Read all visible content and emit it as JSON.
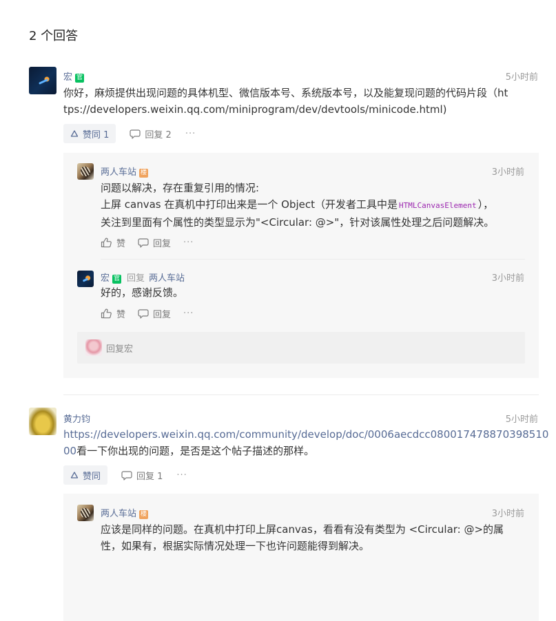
{
  "header": {
    "title": "2 个回答"
  },
  "answers": [
    {
      "author": "宏",
      "badge": "官",
      "time": "5小时前",
      "content_line1": "你好，麻烦提供出现问题的具体机型、微信版本号、系统版本号，以及能复现问题的代码片段（ht",
      "content_line2": "tps://developers.weixin.qq.com/miniprogram/dev/devtools/minicode.html)",
      "like_label": "赞同 1",
      "reply_label": "回复 2",
      "more_label": "···",
      "replies": [
        {
          "author": "两人车站",
          "badge": "楼",
          "time": "3小时前",
          "line1": "问题以解决，存在重复引用的情况:",
          "line2_prefix": "上屏 canvas 在真机中打印出来是一个 Object（开发者工具中是",
          "line2_code": "HTMLCanvasElement",
          "line2_suffix": "），",
          "line3": "关注到里面有个属性的类型显示为\"<Circular: @>\"，针对该属性处理之后问题解决。",
          "like_label": "赞",
          "reply_label": "回复",
          "more_label": "···"
        },
        {
          "author": "宏",
          "badge": "官",
          "reply_word": "回复",
          "reply_target": "两人车站",
          "time": "3小时前",
          "line1": "好的，感谢反馈。",
          "like_label": "赞",
          "reply_label": "回复",
          "more_label": "···"
        }
      ],
      "reply_input_placeholder": "回复宏"
    },
    {
      "author": "黄力钧",
      "time": "5小时前",
      "link_line1": "https://developers.weixin.qq.com/community/develop/doc/0006aecdcc080017478870398510",
      "link_line2": "00",
      "text_after_link": "看一下你出现的问题，是否是这个帖子描述的那样。",
      "like_label": "赞同",
      "reply_label": "回复 1",
      "more_label": "···",
      "replies": [
        {
          "author": "两人车站",
          "badge": "楼",
          "time": "3小时前",
          "line1": "应该是同样的问题。在真机中打印上屏canvas，看看有没有类型为 <Circular: @>的属",
          "line2": "性，如果有，根据实际情况处理一下也许问题能得到解决。"
        }
      ]
    }
  ],
  "icons": {
    "like": "like-icon",
    "thumbs": "thumbs-up-icon",
    "comment": "comment-icon"
  }
}
